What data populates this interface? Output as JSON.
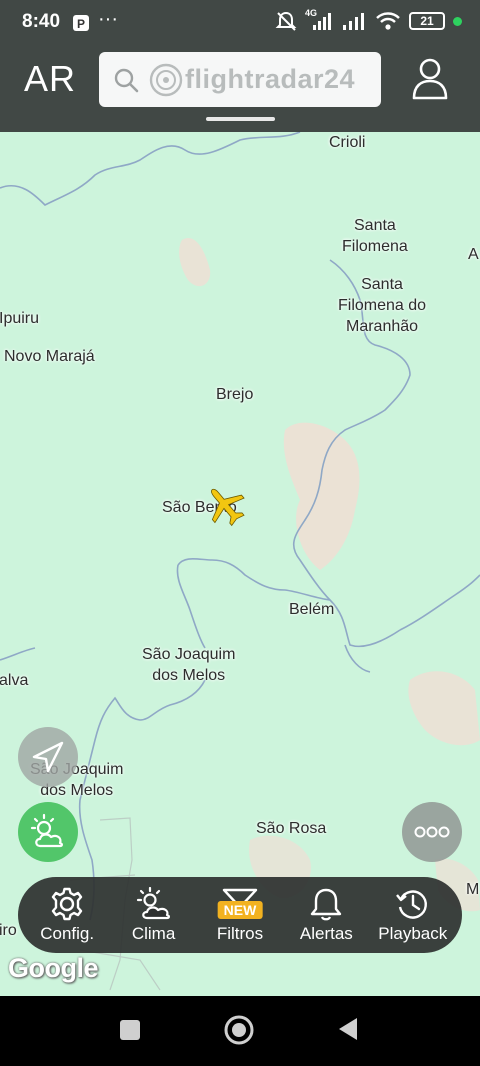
{
  "status_bar": {
    "time": "8:40",
    "network": "4G",
    "battery": "21"
  },
  "header": {
    "logo": "AR",
    "search_brand": "flightradar24",
    "icons": [
      "search-icon",
      "radar-logo-icon",
      "profile-icon"
    ]
  },
  "map": {
    "places": [
      {
        "id": "crioli",
        "name": "Crioli"
      },
      {
        "id": "santa-filomena",
        "name": "Santa\nFilomena"
      },
      {
        "id": "santa-filomena-maranhao",
        "name": "Santa\nFilomena do\nMaranhão"
      },
      {
        "id": "ipuiru",
        "name": "Ipuiru"
      },
      {
        "id": "novo-maraja",
        "name": "Novo Marajá"
      },
      {
        "id": "brejo",
        "name": "Brejo"
      },
      {
        "id": "sao-bento",
        "name": "São Bento"
      },
      {
        "id": "belem",
        "name": "Belém"
      },
      {
        "id": "sao-joaquim-1",
        "name": "São Joaquim\ndos Melos"
      },
      {
        "id": "alva",
        "name": "alva"
      },
      {
        "id": "sao-joaquim-2",
        "name": "São Joaquim\ndos Melos"
      },
      {
        "id": "sao-rosa",
        "name": "São Rosa"
      },
      {
        "id": "iro",
        "name": "iro"
      },
      {
        "id": "edge-a",
        "name": "A"
      },
      {
        "id": "edge-m",
        "name": "M"
      }
    ],
    "aircraft_color": "#f2c611",
    "attribution": "Google"
  },
  "fabs": {
    "locate": "navigation-arrow-icon",
    "weather": "weather-icon",
    "more": "more-dots-icon"
  },
  "bottom_menu": {
    "items": [
      {
        "id": "config",
        "label": "Config.",
        "icon": "gear-icon"
      },
      {
        "id": "clima",
        "label": "Clima",
        "icon": "weather-icon"
      },
      {
        "id": "filtros",
        "label": "Filtros",
        "icon": "filter-icon",
        "badge": "NEW"
      },
      {
        "id": "alertas",
        "label": "Alertas",
        "icon": "bell-icon"
      },
      {
        "id": "playback",
        "label": "Playback",
        "icon": "history-icon"
      }
    ]
  },
  "colors": {
    "map": "#cdf4dc",
    "header": "#323534",
    "weather_fab": "#52c66a",
    "badge": "#f2b220"
  }
}
